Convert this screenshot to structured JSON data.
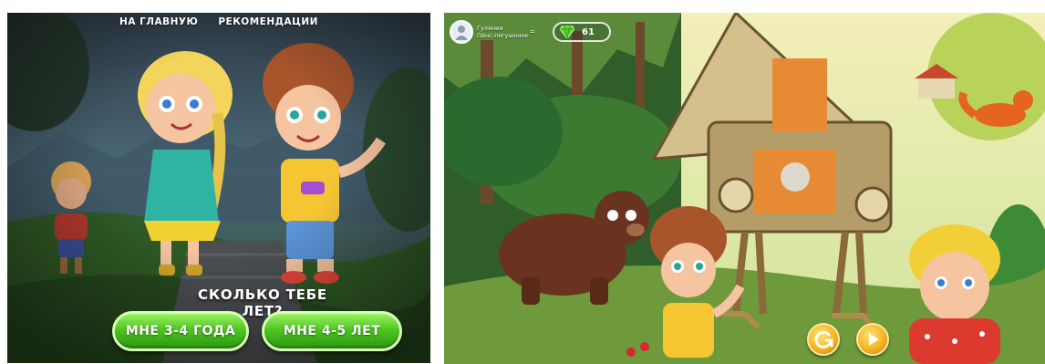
{
  "left_screen": {
    "nav": {
      "home_label": "НА ГЛАВНУЮ",
      "recommendations_label": "РЕКОМЕНДАЦИИ"
    },
    "question": "СКОЛЬКО ТЕБЕ ЛЕТ?",
    "age_options": [
      {
        "label": "МНЕ 3-4 ГОДА"
      },
      {
        "label": "МНЕ 4-5 ЛЕТ"
      }
    ]
  },
  "right_screen": {
    "user": {
      "name_line1": "Гуляния",
      "name_line2": "Пёнс-лягушонок",
      "separator": "="
    },
    "gems": {
      "count": "61",
      "icon": "green-gem-icon"
    },
    "controls": [
      {
        "icon": "replay-icon"
      },
      {
        "icon": "play-icon"
      }
    ]
  },
  "colors": {
    "button_green": "#4fc622",
    "button_gold": "#f5b521",
    "gem_green": "#5ad433"
  }
}
